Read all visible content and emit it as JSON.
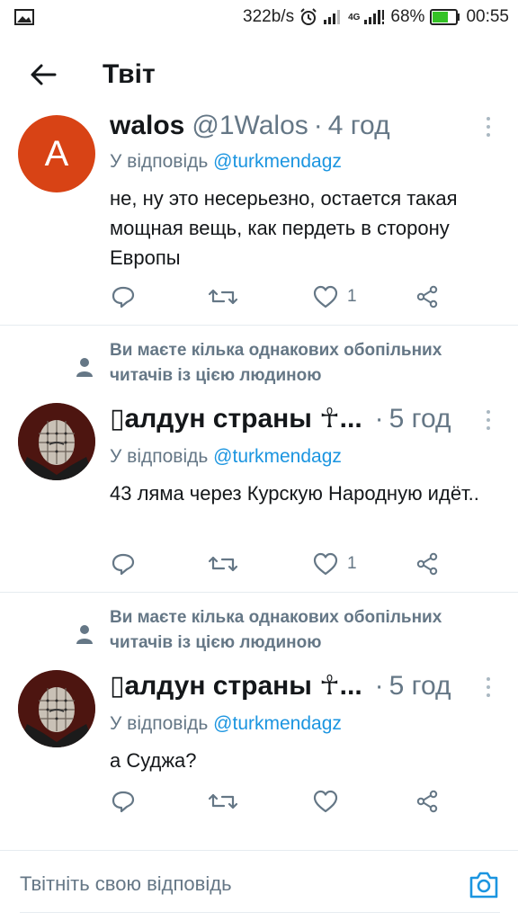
{
  "status_bar": {
    "net_speed": "322b/s",
    "network_type": "4G",
    "battery_percent": "68%",
    "battery_level": 0.68,
    "time": "00:55",
    "icons": [
      "image-icon",
      "alarm-icon",
      "signal-icon",
      "battery-icon"
    ]
  },
  "header": {
    "title": "Твіт",
    "back_icon": "arrow-left-icon"
  },
  "tweets": [
    {
      "avatar_letter": "A",
      "avatar_color": "#d84315",
      "name": "walos",
      "handle": "@1Walos",
      "separator": "·",
      "time": "4 год",
      "reply_prefix": "У відповідь",
      "reply_mention": "@turkmendagz",
      "text": "не, ну это несерьезно, остается такая мощная вещь, как пердеть в сторону Европы",
      "likes": "1"
    },
    {
      "social_context": "Ви маєте кілька однакових обопільних читачів із цією людиною",
      "name": "▯алдун страны ☥...",
      "separator": "·",
      "time": "5 год",
      "reply_prefix": "У відповідь",
      "reply_mention": "@turkmendagz",
      "text": "43 ляма через Курскую Народную идёт..",
      "likes": "1"
    },
    {
      "social_context": "Ви маєте кілька однакових обопільних читачів із цією людиною",
      "name": "▯алдун страны ☥...",
      "separator": "·",
      "time": "5 год",
      "reply_prefix": "У відповідь",
      "reply_mention": "@turkmendagz",
      "text": "а Суджа?",
      "likes": ""
    }
  ],
  "compose": {
    "placeholder": "Твітніть свою відповідь",
    "camera_icon": "camera-icon"
  },
  "colors": {
    "link": "#1b95e0",
    "muted": "#657786",
    "battery_fill": "#35c226"
  }
}
